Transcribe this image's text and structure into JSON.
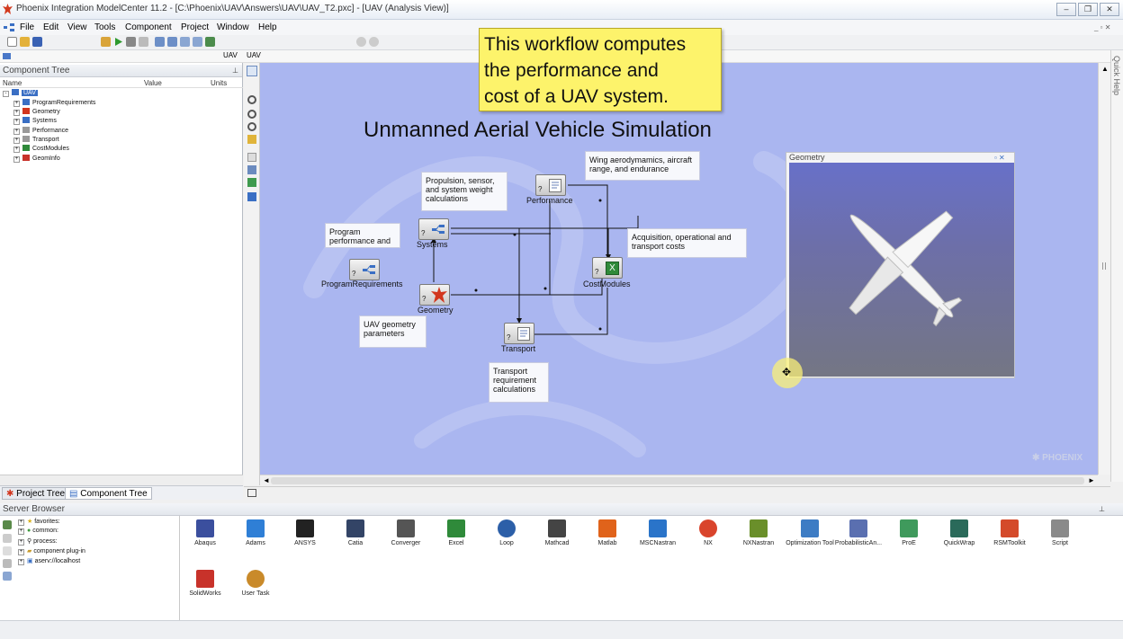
{
  "window": {
    "title": "Phoenix Integration ModelCenter 11.2 - [C:\\Phoenix\\UAV\\Answers\\UAV\\UAV_T2.pxc] - [UAV (Analysis View)]",
    "controls": [
      "–",
      "❐",
      "✕"
    ]
  },
  "menu": [
    "File",
    "Edit",
    "View",
    "Tools",
    "Component",
    "Project",
    "Window",
    "Help"
  ],
  "breadcrumb": [
    "UAV",
    "UAV"
  ],
  "component_tree": {
    "title": "Component Tree",
    "columns": [
      "Name",
      "Value",
      "Units"
    ],
    "root": "UAV",
    "items": [
      "ProgramRequirements",
      "Geometry",
      "Systems",
      "Performance",
      "Transport",
      "CostModules",
      "GeomInfo"
    ]
  },
  "bottom_tabs": [
    "Project Tree",
    "Component Tree"
  ],
  "tooltip": {
    "line1": "This workflow computes",
    "line2": "the performance and",
    "line3": "cost of a UAV system."
  },
  "canvas": {
    "title": "Unmanned Aerial Vehicle Simulation",
    "notes": {
      "propulsion": "Propulsion, sensor, and system weight calculations",
      "wing": "Wing aerodymamics, aircraft range, and endurance",
      "program": "Program performance and",
      "acquisition": "Acquisition, operational and transport costs",
      "geometry_params": "UAV geometry parameters",
      "transport_req": "Transport requirement calculations"
    },
    "nodes": {
      "program_requirements": "ProgramRequirements",
      "systems": "Systems",
      "performance": "Performance",
      "geometry": "Geometry",
      "cost_modules": "CostModules",
      "transport": "Transport"
    },
    "watermark": "PHOENIX",
    "geometry_panel_title": "Geometry"
  },
  "quick_help": "Quick Help",
  "server_browser": {
    "title": "Server Browser",
    "tree": [
      "favorites:",
      "common:",
      "process:",
      "component plug-in",
      "aserv://localhost"
    ],
    "icons": [
      {
        "label": "Abaqus",
        "color": "#3b4f9e"
      },
      {
        "label": "Adams",
        "color": "#2f7fd6"
      },
      {
        "label": "ANSYS",
        "color": "#222222"
      },
      {
        "label": "Catia",
        "color": "#334466"
      },
      {
        "label": "Converger",
        "color": "#555555"
      },
      {
        "label": "Excel",
        "color": "#2f8a3a"
      },
      {
        "label": "Loop",
        "color": "#2c5fa8"
      },
      {
        "label": "Mathcad",
        "color": "#444444"
      },
      {
        "label": "Matlab",
        "color": "#e0631b"
      },
      {
        "label": "MSCNastran",
        "color": "#2a74c9"
      },
      {
        "label": "NX",
        "color": "#d9442c"
      },
      {
        "label": "NXNastran",
        "color": "#6a8f2a"
      },
      {
        "label": "Optimization Tool",
        "color": "#3d7cc4"
      },
      {
        "label": "ProbabilisticAn...",
        "color": "#5a6fb0"
      },
      {
        "label": "ProE",
        "color": "#3f9a5c"
      },
      {
        "label": "QuickWrap",
        "color": "#2a6a5a"
      },
      {
        "label": "RSMToolkit",
        "color": "#d44a2a"
      },
      {
        "label": "Script",
        "color": "#8a8a8a"
      },
      {
        "label": "SolidWorks",
        "color": "#c8322a"
      },
      {
        "label": "User Task",
        "color": "#c98a2a"
      }
    ]
  }
}
